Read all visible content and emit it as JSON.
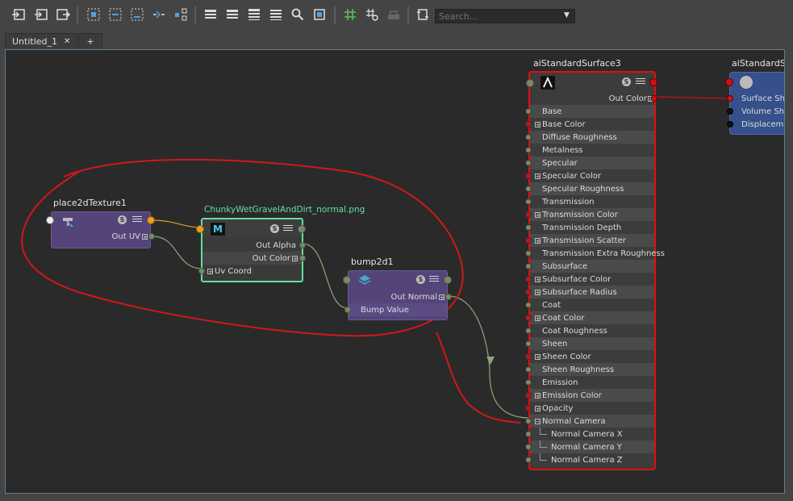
{
  "search": {
    "placeholder": "Search..."
  },
  "tabs": [
    {
      "label": "Untitled_1",
      "close": "✕"
    },
    {
      "label": "+"
    }
  ],
  "nodes": {
    "place2d": {
      "title": "place2dTexture1",
      "badge": "S",
      "ports": [
        "Out UV"
      ]
    },
    "file": {
      "title": "ChunkyWetGravelAndDirt_normal.png",
      "badge": "S",
      "ports": [
        "Out Alpha",
        "Out Color",
        "Uv Coord"
      ]
    },
    "bump": {
      "title": "bump2d1",
      "badge": "S",
      "ports": [
        "Out Normal",
        "Bump Value"
      ]
    },
    "ai3": {
      "title": "aiStandardSurface3",
      "badge": "S",
      "out": "Out Color",
      "attrs": [
        {
          "label": "Base",
          "plus": false,
          "port": "#7a8a6a"
        },
        {
          "label": "Base Color",
          "plus": true,
          "port": "#cc1111"
        },
        {
          "label": "Diffuse Roughness",
          "plus": false,
          "port": "#7a8a6a"
        },
        {
          "label": "Metalness",
          "plus": false,
          "port": "#7a8a6a"
        },
        {
          "label": "Specular",
          "plus": false,
          "port": "#7a8a6a"
        },
        {
          "label": "Specular Color",
          "plus": true,
          "port": "#cc1111"
        },
        {
          "label": "Specular Roughness",
          "plus": false,
          "port": "#7a8a6a"
        },
        {
          "label": "Transmission",
          "plus": false,
          "port": "#7a8a6a"
        },
        {
          "label": "Transmission Color",
          "plus": true,
          "port": "#cc1111"
        },
        {
          "label": "Transmission Depth",
          "plus": false,
          "port": "#7a8a6a"
        },
        {
          "label": "Transmission Scatter",
          "plus": true,
          "port": "#cc1111"
        },
        {
          "label": "Transmission Extra Roughness",
          "plus": false,
          "port": "#7a8a6a"
        },
        {
          "label": "Subsurface",
          "plus": false,
          "port": "#7a8a6a"
        },
        {
          "label": "Subsurface Color",
          "plus": true,
          "port": "#cc1111"
        },
        {
          "label": "Subsurface Radius",
          "plus": true,
          "port": "#cc1111"
        },
        {
          "label": "Coat",
          "plus": false,
          "port": "#7a8a6a"
        },
        {
          "label": "Coat Color",
          "plus": true,
          "port": "#cc1111"
        },
        {
          "label": "Coat Roughness",
          "plus": false,
          "port": "#7a8a6a"
        },
        {
          "label": "Sheen",
          "plus": false,
          "port": "#7a8a6a"
        },
        {
          "label": "Sheen Color",
          "plus": true,
          "port": "#cc1111"
        },
        {
          "label": "Sheen Roughness",
          "plus": false,
          "port": "#7a8a6a"
        },
        {
          "label": "Emission",
          "plus": false,
          "port": "#7a8a6a"
        },
        {
          "label": "Emission Color",
          "plus": true,
          "port": "#cc1111"
        },
        {
          "label": "Opacity",
          "plus": true,
          "port": "#cc1111"
        },
        {
          "label": "Normal Camera",
          "plus": true,
          "minus": true,
          "port": "#7a8a6a"
        },
        {
          "label": "Normal Camera X",
          "plus": false,
          "child": true,
          "port": "#7a8a6a"
        },
        {
          "label": "Normal Camera Y",
          "plus": false,
          "child": true,
          "port": "#7a8a6a"
        },
        {
          "label": "Normal Camera Z",
          "plus": false,
          "child": true,
          "port": "#7a8a6a"
        }
      ]
    },
    "sg": {
      "title": "aiStandardSu",
      "ports": [
        "Surface Sha",
        "Volume Sha",
        "Displaceme"
      ]
    }
  },
  "colors": {
    "utility_node": "#55447a",
    "file_node_border": "#62e0a0",
    "shader_border": "#e01010",
    "sg_node": "#35508a",
    "annotation": "#d01818",
    "connection": "#8ea67a",
    "uv_connection": "#e0a020"
  }
}
